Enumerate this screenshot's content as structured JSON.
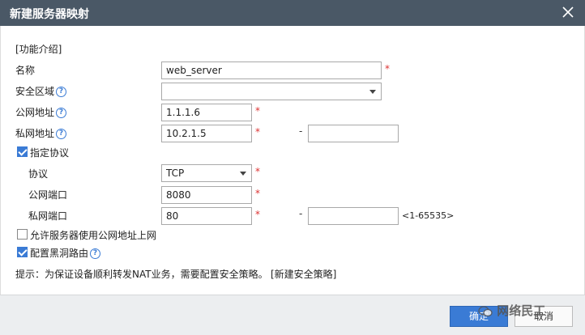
{
  "dialog": {
    "title": "新建服务器映射"
  },
  "form": {
    "intro_link": "[功能介绍]",
    "name_label": "名称",
    "name_value": "web_server",
    "zone_label": "安全区域",
    "zone_value": "",
    "public_ip_label": "公网地址",
    "public_ip_value": "1.1.1.6",
    "private_ip_label": "私网地址",
    "private_ip_value": "10.2.1.5",
    "private_ip_end_value": "",
    "range_dash": "-",
    "specify_protocol_label": "指定协议",
    "specify_protocol_checked": true,
    "protocol_label": "协议",
    "protocol_value": "TCP",
    "public_port_label": "公网端口",
    "public_port_value": "8080",
    "private_port_label": "私网端口",
    "private_port_value": "80",
    "private_port_end_value": "",
    "port_range_hint": "<1-65535>",
    "allow_server_public_label": "允许服务器使用公网地址上网",
    "allow_server_public_checked": false,
    "blackhole_route_label": "配置黑洞路由",
    "blackhole_route_checked": true,
    "tip_text": "提示：为保证设备顺利转发NAT业务，需要配置安全策略。",
    "new_policy_link": "[新建安全策略]",
    "required_mark": "*",
    "help_glyph": "?"
  },
  "footer": {
    "ok_label": "确定",
    "cancel_label": "取消",
    "watermark": "网络民工"
  }
}
